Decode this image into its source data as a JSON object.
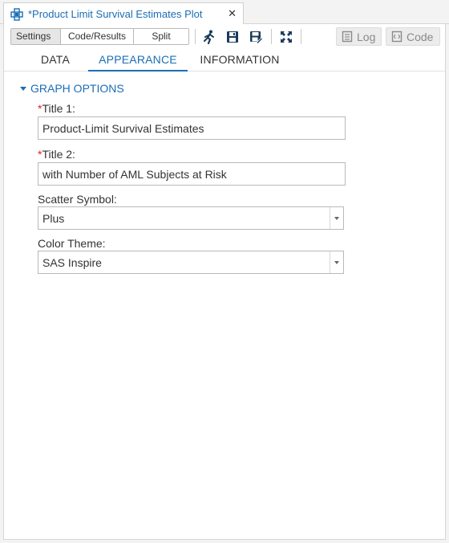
{
  "window": {
    "tab_title": "*Product Limit Survival Estimates Plot",
    "close_glyph": "✕"
  },
  "toolbar": {
    "view_modes": [
      "Settings",
      "Code/Results",
      "Split"
    ],
    "selected_view": "Settings",
    "icons": [
      "run-icon",
      "save-icon",
      "save-as-icon",
      "maximize-icon"
    ],
    "log_label": "Log",
    "code_label": "Code"
  },
  "tabs": {
    "items": [
      "DATA",
      "APPEARANCE",
      "INFORMATION"
    ],
    "active": "APPEARANCE"
  },
  "graph_options": {
    "section_label": "GRAPH OPTIONS",
    "required_marker": "*",
    "title1_label": "Title 1:",
    "title1_value": "Product-Limit Survival Estimates",
    "title2_label": "Title 2:",
    "title2_value": "with Number of AML Subjects at Risk",
    "scatter_label": "Scatter Symbol:",
    "scatter_value": "Plus",
    "color_theme_label": "Color Theme:",
    "color_theme_value": "SAS Inspire"
  },
  "colors": {
    "accent": "#1a6eb5",
    "required": "#d9261c"
  }
}
